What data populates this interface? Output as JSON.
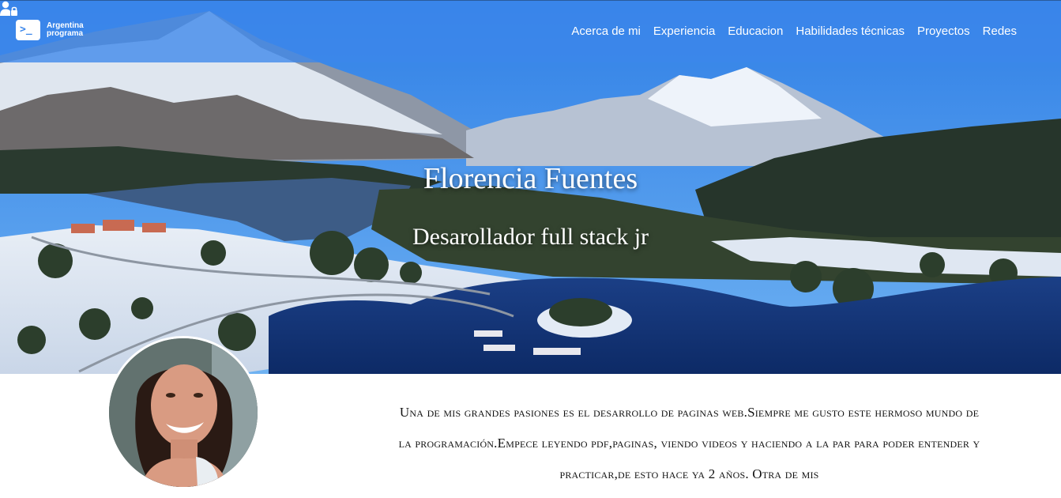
{
  "brand": {
    "line1": "Argentina",
    "line2": "programa",
    "icon": "terminal-prompt-icon"
  },
  "nav": {
    "items": [
      {
        "label": "Acerca de mi"
      },
      {
        "label": "Experiencia"
      },
      {
        "label": "Educacion"
      },
      {
        "label": "Habilidades técnicas"
      },
      {
        "label": "Proyectos"
      },
      {
        "label": "Redes"
      }
    ],
    "login_icon": "user-lock-icon"
  },
  "hero": {
    "name": "Florencia Fuentes",
    "role": "Desarollador full stack jr"
  },
  "about": {
    "text": "Una de mis grandes pasiones es el desarrollo de paginas web.Siempre me gusto este hermoso mundo de la programación.Empece leyendo pdf,paginas, viendo videos y haciendo a la par para poder entender y practicar,de esto hace ya 2 años. Otra de mis"
  },
  "colors": {
    "navbar": "#3c87eb",
    "hero_text": "#ffffff",
    "body_text": "#111111"
  }
}
